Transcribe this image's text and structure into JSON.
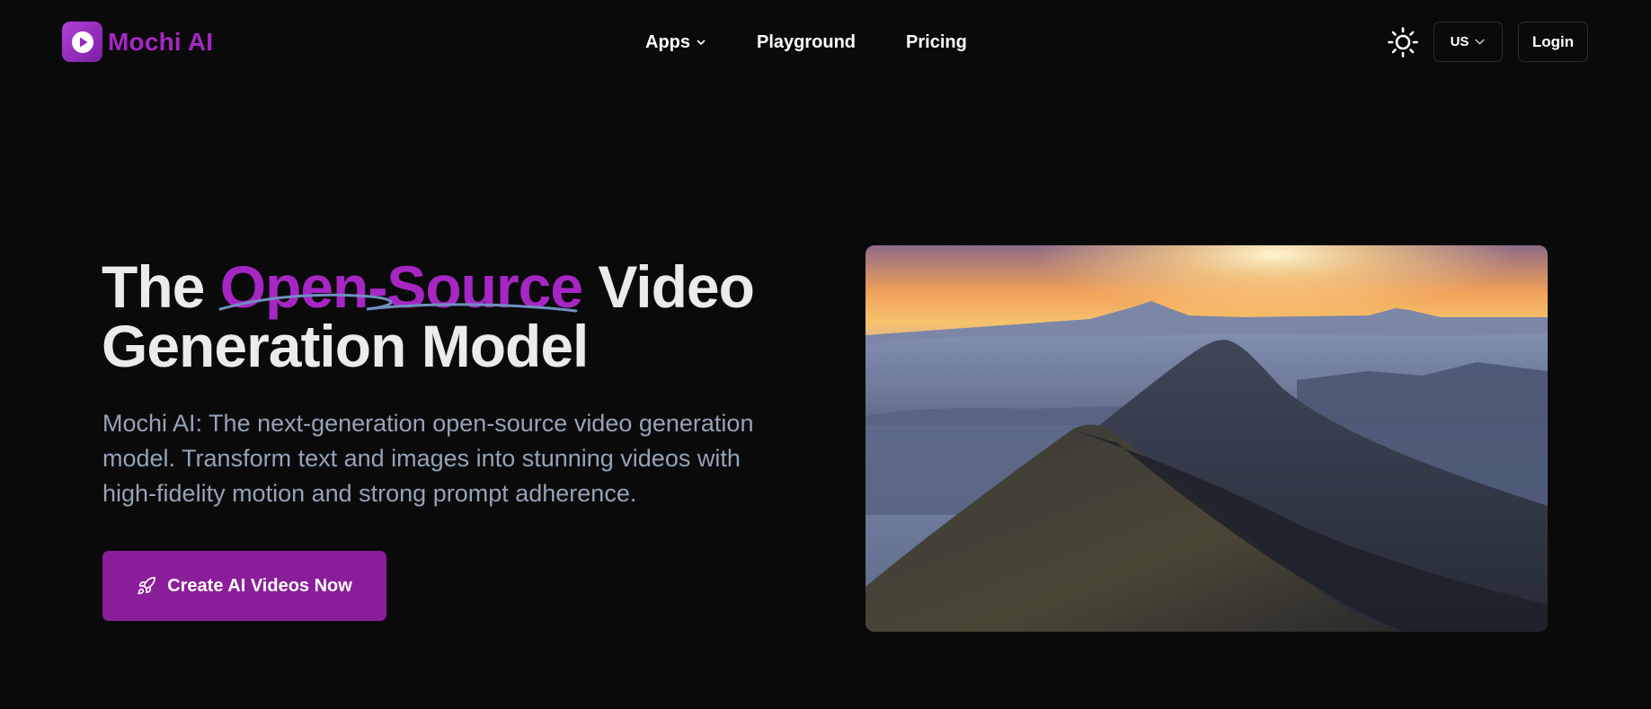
{
  "brand": {
    "name": "Mochi AI",
    "accent_color": "#a626c4",
    "logo_icon": "play-icon"
  },
  "nav": {
    "apps_label": "Apps",
    "playground_label": "Playground",
    "pricing_label": "Pricing"
  },
  "header_actions": {
    "theme_icon": "sun-icon",
    "region_label": "US",
    "login_label": "Login"
  },
  "hero": {
    "title_prefix": "The ",
    "title_accent": "Open-Source",
    "title_suffix": " Video Generation Model",
    "description": "Mochi AI: The next-generation open-source video generation model. Transform text and images into stunning videos with high-fidelity motion and strong prompt adherence.",
    "cta_label": "Create AI Videos Now",
    "cta_icon": "rocket-icon",
    "cta_color": "#8a1d99",
    "media_subject": "mountain-sunset-video"
  },
  "colors": {
    "background": "#0a0a0a",
    "description_text": "#94a3b8",
    "title_text": "#ebebeb"
  }
}
